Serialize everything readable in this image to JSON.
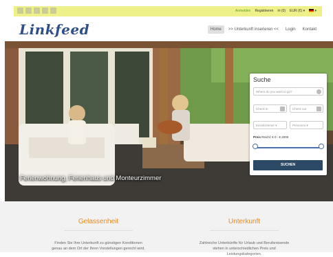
{
  "topbar": {
    "social_icons": [
      "facebook-icon",
      "twitter-icon",
      "google-plus-icon",
      "linkedin-icon",
      "rss-icon"
    ],
    "links": {
      "anmelden": "Anmelden",
      "registrieren": "Registrieren",
      "cart": "(0)",
      "currency": "EUR (€) ▾",
      "language": "▾"
    }
  },
  "nav": {
    "logo": "Linkfeed",
    "items": [
      "Home",
      ">> Unterkunft inserieren <<",
      "Login",
      "Kontakt"
    ]
  },
  "hero": {
    "caption": "Ferienwohnung, Ferienhaus und Monteurzimmer"
  },
  "search": {
    "title": "Suche",
    "where_placeholder": "Where do you want to go?",
    "checkin": "Check in",
    "checkout": "Check out",
    "rooms": "Einzelzimmer ▾",
    "persons": "Personen ▾",
    "price_label": "Preis",
    "price_range": "Reichl: € 0 - € 2000",
    "price_min_fraction": 0,
    "price_max_fraction": 1,
    "button": "SUCHEN"
  },
  "features": [
    {
      "title": "Gelassenheit",
      "text": "Finden Sie Ihre Unterkunft zu günstigen Konditionen genau an dem Ort der Ihren Vorstellungen gerecht wird."
    },
    {
      "title": "Unterkunft",
      "text": "Zahlreiche Unterkünfte für Urlaub und Berufsreisende stehen in unterschiedlichen Preis und Leistungskategorien."
    }
  ],
  "colors": {
    "topbar": "#eef089",
    "logo": "#2f4f86",
    "accent_orange": "#e88a1f",
    "search_button": "#2c4a66"
  }
}
